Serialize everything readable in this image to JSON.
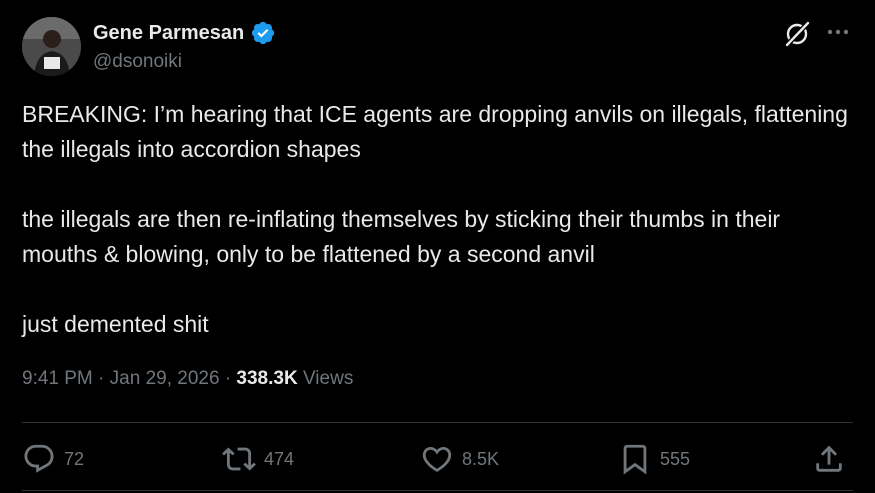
{
  "author": {
    "name": "Gene Parmesan",
    "handle": "@dsonoiki",
    "verified": true
  },
  "icons": {
    "verified": "verified-badge-icon",
    "grok": "grok-icon",
    "more": "more-icon",
    "reply": "reply-icon",
    "repost": "repost-icon",
    "like": "like-icon",
    "bookmark": "bookmark-icon",
    "share": "share-icon"
  },
  "colors": {
    "background": "#000000",
    "text": "#e7e9ea",
    "muted": "#71767b",
    "verified": "#1d9bf0",
    "divider": "#2f3336"
  },
  "post": {
    "paragraphs": [
      "BREAKING: I’m hearing that ICE agents are dropping anvils on illegals, flattening the illegals into accordion shapes",
      "the illegals are then re-inflating themselves by sticking their thumbs in their mouths & blowing, only to be flattened by a second anvil",
      "just demented shit"
    ],
    "time": "9:41 PM",
    "separator": " · ",
    "date": "Jan 29, 2026",
    "views_count": "338.3K",
    "views_label": " Views"
  },
  "actions": {
    "replies": "72",
    "reposts": "474",
    "likes": "8.5K",
    "bookmarks": "555"
  }
}
